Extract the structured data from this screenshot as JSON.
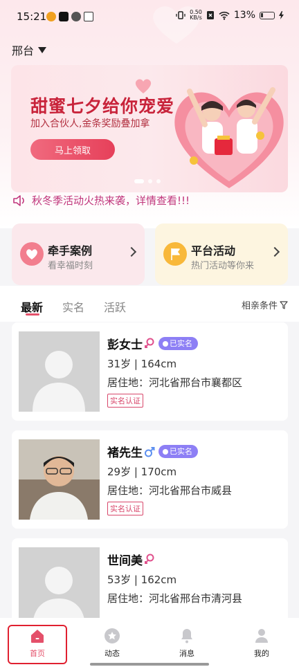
{
  "status_bar": {
    "time": "15:21",
    "net_speed_value": "0.50",
    "net_speed_unit": "KB/s",
    "battery": "13%"
  },
  "location": {
    "city": "邢台"
  },
  "banner": {
    "title": "甜蜜七夕给你宠爱",
    "subtitle": "加入合伙人,金条奖励叠加拿",
    "button": "马上领取",
    "slide_count": 3,
    "active_slide": 1
  },
  "notice": {
    "text": "秋冬季活动火热来袭，详情查看!!!"
  },
  "features": [
    {
      "title": "牵手案例",
      "subtitle": "看幸福时刻",
      "icon": "heart-hands-icon",
      "color": "#f27e8e"
    },
    {
      "title": "平台活动",
      "subtitle": "热门活动等你来",
      "icon": "flag-icon",
      "color": "#f8b83a"
    }
  ],
  "tabs": [
    {
      "label": "最新",
      "active": true
    },
    {
      "label": "实名",
      "active": false
    },
    {
      "label": "活跃",
      "active": false
    }
  ],
  "filter": {
    "label": "相亲条件"
  },
  "members": [
    {
      "name": "彭女士",
      "gender": "female",
      "verified_badge": "已实名",
      "age_height": "31岁 | 164cm",
      "residence": "居住地：河北省邢台市襄都区",
      "tag": "实名认证",
      "photo": "placeholder"
    },
    {
      "name": "褚先生",
      "gender": "male",
      "verified_badge": "已实名",
      "age_height": "29岁 | 170cm",
      "residence": "居住地：河北省邢台市威县",
      "tag": "实名认证",
      "photo": "real"
    },
    {
      "name": "世间美",
      "gender": "female",
      "verified_badge": "",
      "age_height": "53岁 | 162cm",
      "residence": "居住地：河北省邢台市清河县",
      "tag": "",
      "photo": "placeholder"
    }
  ],
  "bottom_nav": [
    {
      "label": "首页",
      "icon": "home-icon",
      "active": true
    },
    {
      "label": "动态",
      "icon": "star-icon",
      "active": false
    },
    {
      "label": "消息",
      "icon": "bell-icon",
      "active": false
    },
    {
      "label": "我的",
      "icon": "profile-icon",
      "active": false
    }
  ],
  "colors": {
    "accent": "#e4506a",
    "verified": "#8d7ff5",
    "female": "#e0508c",
    "male": "#5c8ff0"
  }
}
